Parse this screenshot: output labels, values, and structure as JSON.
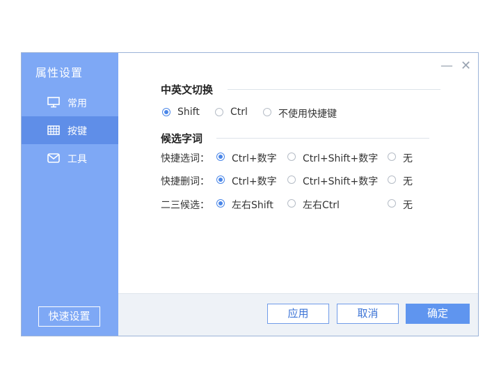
{
  "sidebar": {
    "title": "属性设置",
    "items": [
      {
        "label": "常用",
        "icon": "monitor-icon"
      },
      {
        "label": "按键",
        "icon": "keyboard-icon"
      },
      {
        "label": "工具",
        "icon": "envelope-icon"
      }
    ],
    "active_index": 1,
    "quick_settings_label": "快速设置"
  },
  "window": {
    "minimize_glyph": "—",
    "close_glyph": "✕"
  },
  "section_lang": {
    "title": "中英文切换",
    "options": [
      "Shift",
      "Ctrl",
      "不使用快捷键"
    ],
    "selected": "Shift"
  },
  "section_candidates": {
    "title": "候选字词",
    "rows": [
      {
        "label": "快捷选词：",
        "options": [
          "Ctrl+数字",
          "Ctrl+Shift+数字",
          "无"
        ],
        "selected": "Ctrl+数字"
      },
      {
        "label": "快捷删词：",
        "options": [
          "Ctrl+数字",
          "Ctrl+Shift+数字",
          "无"
        ],
        "selected": "Ctrl+数字"
      },
      {
        "label": "二三候选：",
        "options": [
          "左右Shift",
          "左右Ctrl",
          "无"
        ],
        "selected": "左右Shift"
      }
    ]
  },
  "footer": {
    "apply_label": "应用",
    "cancel_label": "取消",
    "ok_label": "确定"
  },
  "colors": {
    "sidebar_bg": "#7ea8f5",
    "sidebar_active": "#5f8ee8",
    "accent": "#4a86e8",
    "primary_button": "#5f95ef"
  }
}
